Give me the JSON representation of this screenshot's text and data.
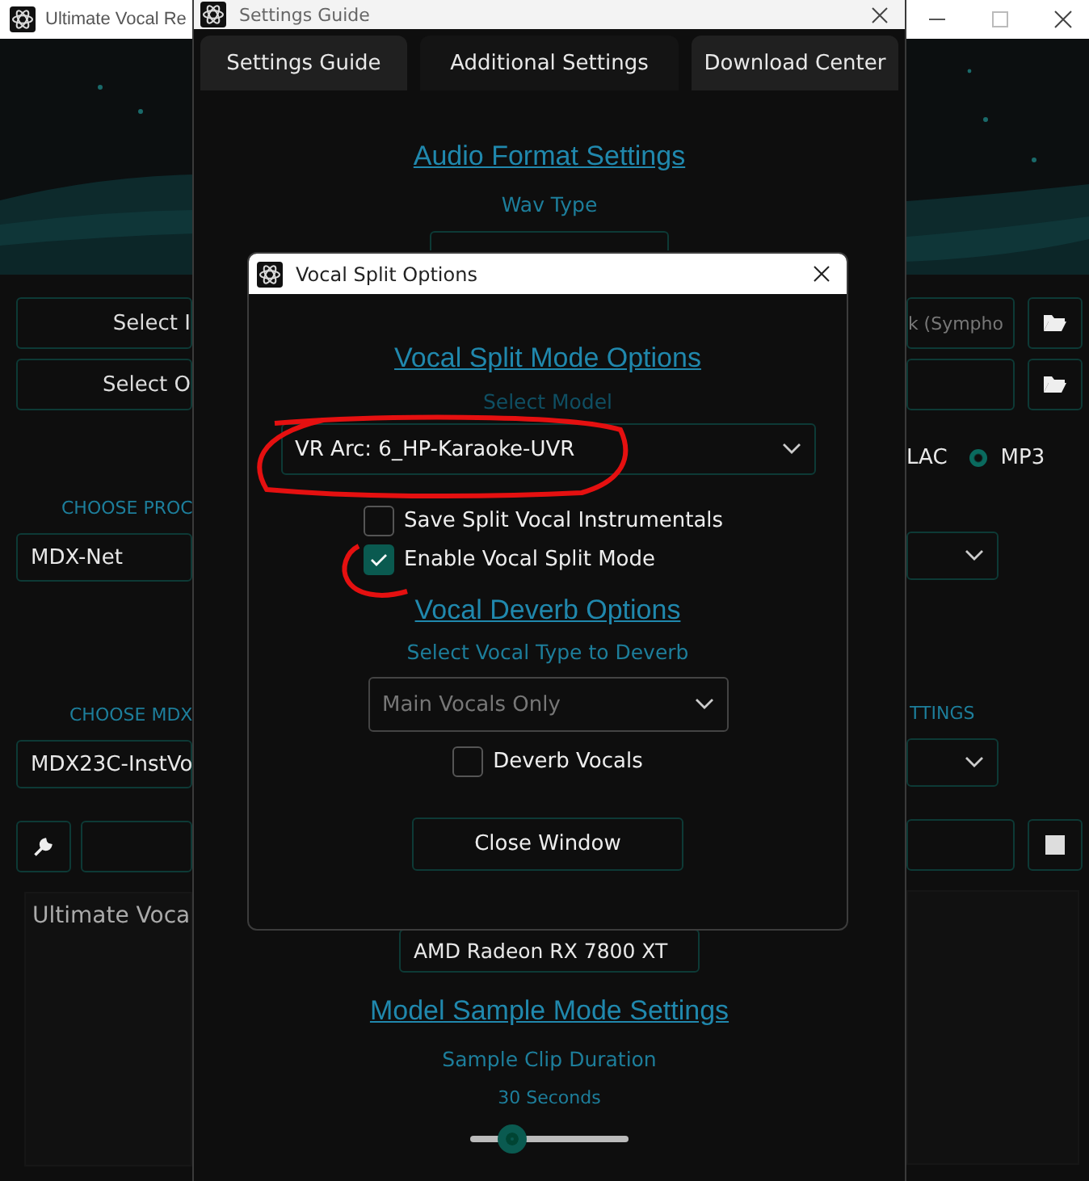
{
  "main_window": {
    "title": "Ultimate Vocal Re",
    "left": {
      "buttons": [
        "Select I",
        "Select O"
      ],
      "process_label": "CHOOSE PROC",
      "process_value": "MDX-Net",
      "model_label": "CHOOSE MDX",
      "model_value": "MDX23C-InstVo",
      "console_text": "Ultimate Voca"
    },
    "right": {
      "input_path": "k (Sympho",
      "flac_label": "LAC",
      "mp3": {
        "label": "MP3",
        "selected": true
      },
      "settings_label": "TTINGS"
    }
  },
  "settings_window": {
    "title": "Settings Guide",
    "tabs": [
      {
        "label": "Settings Guide",
        "selected": false
      },
      {
        "label": "Additional Settings",
        "selected": true
      },
      {
        "label": "Download Center",
        "selected": false
      }
    ],
    "audio_format_heading": "Audio Format Settings",
    "wav_type_label": "Wav Type",
    "gpu_value": "AMD Radeon RX 7800 XT",
    "sample_heading": "Model Sample Mode Settings",
    "clip_label": "Sample Clip Duration",
    "clip_value": "30 Seconds",
    "clip_slider": {
      "level": 0.27
    }
  },
  "dialog": {
    "title": "Vocal Split Options",
    "split_heading": "Vocal Split Mode Options",
    "model_label": "Select Model",
    "model_value": "VR Arc: 6_HP-Karaoke-UVR",
    "checkboxes": [
      {
        "label": "Save Split Vocal Instrumentals",
        "checked": false
      },
      {
        "label": "Enable Vocal Split Mode",
        "checked": true
      }
    ],
    "deverb_heading": "Vocal Deverb Options",
    "deverb_type_label": "Select Vocal Type to Deverb",
    "deverb_type": {
      "value": "Main Vocals Only",
      "disabled": true
    },
    "deverb_checkbox": {
      "label": "Deverb Vocals",
      "checked": false
    },
    "close_button": "Close Window"
  },
  "annotations": [
    {
      "kind": "ellipse"
    },
    {
      "kind": "circle"
    }
  ]
}
